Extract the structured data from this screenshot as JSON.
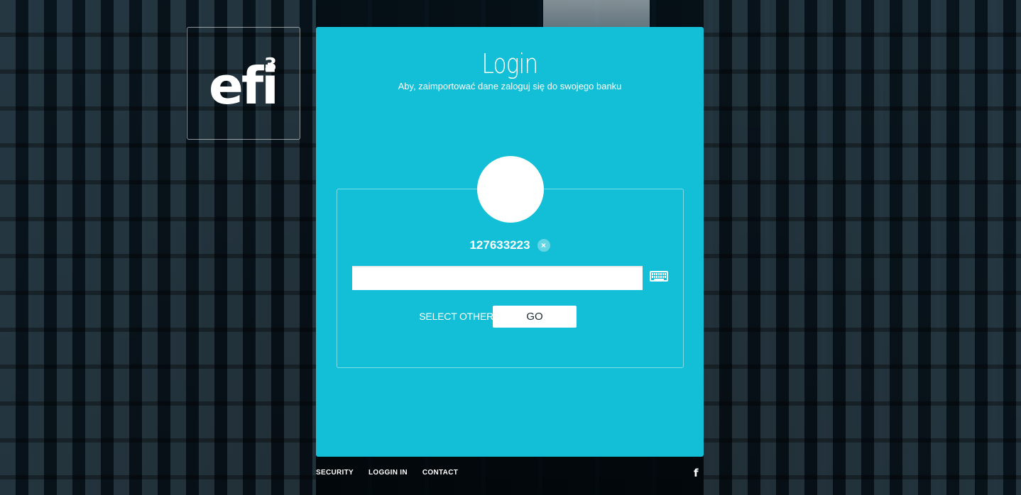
{
  "brand": {
    "logo_text": "efi",
    "logo_sup": "3"
  },
  "login": {
    "title": "Login",
    "subtitle": "Aby, zaimportować dane zaloguj się do swojego banku",
    "account_number": "127633223",
    "clear_icon": "close-icon",
    "clear_symbol": "×",
    "password_value": "",
    "password_placeholder": "",
    "keyboard_icon": "keyboard-icon",
    "select_other_label": "SELECT OTHER",
    "go_label": "GO"
  },
  "footer": {
    "links": [
      "SECURITY",
      "LOGGIN IN",
      "CONTACT"
    ],
    "facebook_icon": "facebook-icon",
    "facebook_glyph": "f"
  },
  "colors": {
    "card": "#12bfd6",
    "text": "#ffffff"
  }
}
